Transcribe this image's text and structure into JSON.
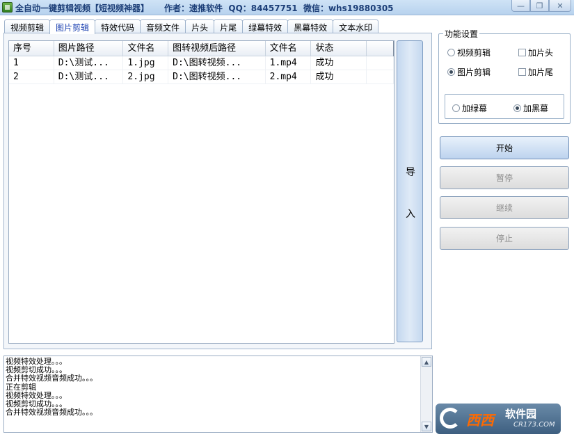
{
  "window": {
    "title": "全自动一键剪辑视频【短视频神器】",
    "author": "作者：速推软件",
    "qq": "QQ：84457751",
    "wechat": "微信：whs19880305",
    "min_glyph": "—",
    "restore_glyph": "❐",
    "close_glyph": "✕"
  },
  "tabs": [
    {
      "label": "视频剪辑",
      "active": false
    },
    {
      "label": "图片剪辑",
      "active": true
    },
    {
      "label": "特效代码",
      "active": false
    },
    {
      "label": "音频文件",
      "active": false
    },
    {
      "label": "片头",
      "active": false
    },
    {
      "label": "片尾",
      "active": false
    },
    {
      "label": "绿幕特效",
      "active": false
    },
    {
      "label": "黑幕特效",
      "active": false
    },
    {
      "label": "文本水印",
      "active": false
    }
  ],
  "table": {
    "columns": [
      "序号",
      "图片路径",
      "文件名",
      "图转视频后路径",
      "文件名",
      "状态",
      ""
    ],
    "rows": [
      [
        "1",
        "D:\\测试...",
        "1.jpg",
        "D:\\图转视频...",
        "1.mp4",
        "成功",
        ""
      ],
      [
        "2",
        "D:\\测试...",
        "2.jpg",
        "D:\\图转视频...",
        "2.mp4",
        "成功",
        ""
      ]
    ]
  },
  "import_button": {
    "char1": "导",
    "char2": "入"
  },
  "settings": {
    "title": "功能设置",
    "video_edit": "视频剪辑",
    "image_edit": "图片剪辑",
    "add_intro": "加片头",
    "add_outro": "加片尾",
    "green_screen": "加绿幕",
    "black_screen": "加黑幕"
  },
  "buttons": {
    "start": "开始",
    "pause": "暂停",
    "resume": "继续",
    "stop": "停止"
  },
  "log": {
    "lines": [
      "视频特效处理。。。",
      "视频剪切成功。。。",
      "合并特效视频音频成功。。。",
      "正在剪辑",
      "视频特效处理。。。",
      "视频剪切成功。。。",
      "合并特效视频音频成功。。。"
    ],
    "scroll_up_glyph": "▲",
    "scroll_down_glyph": "▼"
  },
  "logo": {
    "brand": "西西",
    "suffix": "软件园",
    "url": "CR173.COM"
  }
}
